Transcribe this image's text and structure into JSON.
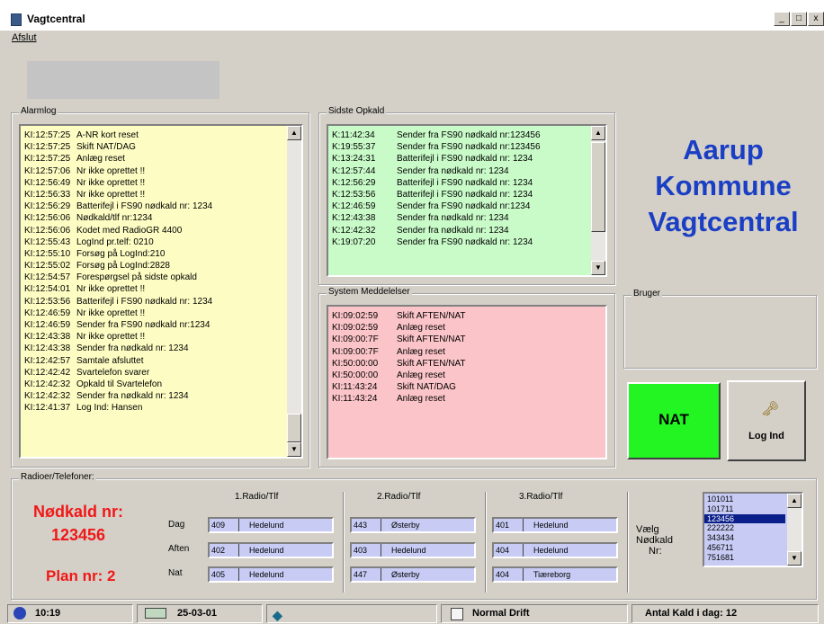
{
  "window": {
    "title": "Vagtcentral",
    "controls": [
      "_",
      "□",
      "x"
    ]
  },
  "menu": {
    "items": [
      {
        "label": "Afslut"
      }
    ]
  },
  "alarmlog": {
    "label": "Alarmlog",
    "rows": [
      {
        "time": "KI:12:57:25",
        "text": "A-NR kort reset"
      },
      {
        "time": "KI:12:57:25",
        "text": "Skift NAT/DAG"
      },
      {
        "time": "KI:12:57:25",
        "text": "Anlæg reset"
      },
      {
        "time": "KI:12:57:06",
        "text": "Nr ikke oprettet !!"
      },
      {
        "time": "KI:12:56:49",
        "text": "Nr ikke oprettet !!"
      },
      {
        "time": "KI:12:56:33",
        "text": "Nr ikke oprettet !!"
      },
      {
        "time": "KI:12:56:29",
        "text": "Batterifejl i FS90 nødkald nr: 1234"
      },
      {
        "time": "KI:12:56:06",
        "text": "Nødkald/tlf nr:1234"
      },
      {
        "time": "KI:12:56:06",
        "text": "Kodet med RadioGR 4400"
      },
      {
        "time": "KI:12:55:43",
        "text": "LogInd pr.telf: 0210"
      },
      {
        "time": "KI:12:55:10",
        "text": "Forsøg på LogInd:210"
      },
      {
        "time": "KI:12:55:02",
        "text": "Forsøg på LogInd:2828"
      },
      {
        "time": "KI:12:54:57",
        "text": "Forespørgsel på sidste opkald"
      },
      {
        "time": "KI:12:54:01",
        "text": "Nr ikke oprettet !!"
      },
      {
        "time": "KI:12:53:56",
        "text": "Batterifejl i FS90 nødkald nr: 1234"
      },
      {
        "time": "KI:12:46:59",
        "text": "Nr ikke oprettet !!"
      },
      {
        "time": "KI:12:46:59",
        "text": "Sender fra FS90 nødkald nr:1234"
      },
      {
        "time": "KI:12:43:38",
        "text": "Nr ikke oprettet !!"
      },
      {
        "time": "KI:12:43:38",
        "text": "Sender fra nødkald nr: 1234"
      },
      {
        "time": "KI:12:42:57",
        "text": "Samtale afsluttet"
      },
      {
        "time": "KI:12:42:42",
        "text": "Svartelefon svarer"
      },
      {
        "time": "KI:12:42:32",
        "text": "Opkald til Svartelefon"
      },
      {
        "time": "KI:12:42:32",
        "text": "Sender fra nødkald nr: 1234"
      },
      {
        "time": "KI:12:41:37",
        "text": "Log Ind: Hansen"
      }
    ]
  },
  "sidste_opkald": {
    "label": "Sidste Opkald",
    "rows": [
      {
        "time": "K:11:42:34",
        "text": "Sender fra FS90 nødkald nr:123456"
      },
      {
        "time": "K:19:55:37",
        "text": "Sender fra FS90 nødkald nr:123456"
      },
      {
        "time": "K:13:24:31",
        "text": "Batterifejl i FS90 nødkald nr: 1234"
      },
      {
        "time": "K:12:57:44",
        "text": "Sender fra nødkald nr: 1234"
      },
      {
        "time": "K:12:56:29",
        "text": "Batterifejl i FS90 nødkald nr: 1234"
      },
      {
        "time": "K:12:53:56",
        "text": "Batterifejl i FS90 nødkald nr: 1234"
      },
      {
        "time": "K:12:46:59",
        "text": "Sender fra FS90 nødkald nr:1234"
      },
      {
        "time": "K:12:43:38",
        "text": "Sender fra nødkald nr: 1234"
      },
      {
        "time": "K:12:42:32",
        "text": "Sender fra nødkald nr: 1234"
      },
      {
        "time": "K:19:07:20",
        "text": "Sender fra FS90 nødkald nr: 1234"
      }
    ]
  },
  "system_meddelelser": {
    "label": "System Meddelelser",
    "rows": [
      {
        "time": "KI:09:02:59",
        "text": "Skift AFTEN/NAT"
      },
      {
        "time": "KI:09:02:59",
        "text": "Anlæg reset"
      },
      {
        "time": "KI:09:00:7F",
        "text": "Skift AFTEN/NAT"
      },
      {
        "time": "KI:09:00:7F",
        "text": "Anlæg reset"
      },
      {
        "time": "KI:50:00:00",
        "text": "Skift AFTEN/NAT"
      },
      {
        "time": "KI:50:00:00",
        "text": "Anlæg reset"
      },
      {
        "time": "KI:11:43:24",
        "text": "Skift NAT/DAG"
      },
      {
        "time": "KI:11:43:24",
        "text": "Anlæg reset"
      }
    ]
  },
  "logo": {
    "line1": "Aarup",
    "line2": "Kommune",
    "line3": "Vagtcentral"
  },
  "bruger": {
    "label": "Bruger"
  },
  "nat_button": {
    "label": "NAT"
  },
  "logind_button": {
    "label": "Log Ind"
  },
  "radioer": {
    "label": "Radioer/Telefoner:",
    "nodkald_label": "Nødkald nr:",
    "nodkald_value": "123456",
    "plan_label": "Plan nr: 2",
    "row_labels": [
      "Dag",
      "Aften",
      "Nat"
    ],
    "columns": [
      {
        "title": "1.Radio/Tlf",
        "cells": [
          {
            "code": "409",
            "name": "Hedelund"
          },
          {
            "code": "402",
            "name": "Hedelund"
          },
          {
            "code": "405",
            "name": "Hedelund"
          }
        ]
      },
      {
        "title": "2.Radio/Tlf",
        "cells": [
          {
            "code": "443",
            "name": "Østerby"
          },
          {
            "code": "403",
            "name": "Hedelund"
          },
          {
            "code": "447",
            "name": "Østerby"
          }
        ]
      },
      {
        "title": "3.Radio/Tlf",
        "cells": [
          {
            "code": "401",
            "name": "Hedelund"
          },
          {
            "code": "404",
            "name": "Hedelund"
          },
          {
            "code": "404",
            "name": "Tiæreborg"
          }
        ]
      }
    ],
    "vaelg_label": [
      "Vælg",
      "Nødkald",
      "Nr:"
    ],
    "numbers": [
      "101011",
      "101711",
      "123456",
      "222222",
      "343434",
      "456711",
      "751681"
    ],
    "selected_number": "123456"
  },
  "statusbar": {
    "time": "10:19",
    "date": "25-03-01",
    "mode": "Normal Drift",
    "count_label": "Antal Kald i dag:",
    "count_value": "12"
  }
}
